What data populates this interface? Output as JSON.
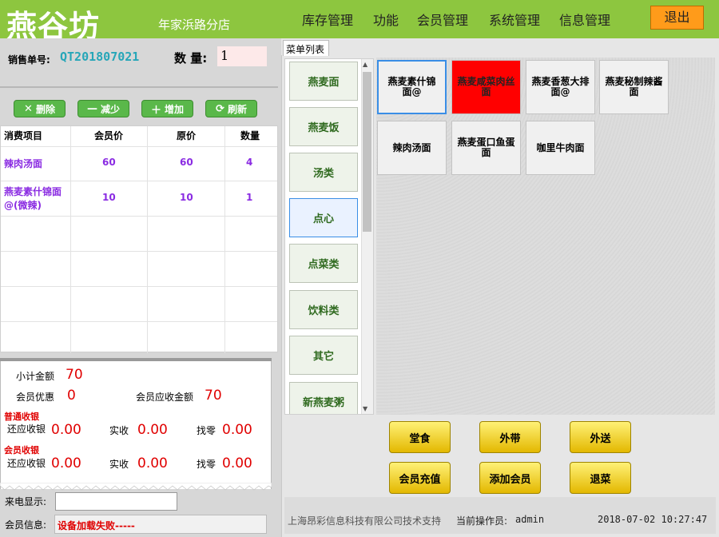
{
  "header": {
    "logo": "燕谷坊",
    "branch": "年家浜路分店",
    "menus": [
      "库存管理",
      "功能",
      "会员管理",
      "系统管理",
      "信息管理"
    ],
    "exit_label": "退出",
    "color": "#8dc63f"
  },
  "order": {
    "no_label": "销售单号:",
    "no": "QT201807021",
    "qty_label": "数 量:",
    "qty": "1"
  },
  "actions": {
    "delete": "删除",
    "decrease": "减少",
    "increase": "增加",
    "refresh": "刷新"
  },
  "table": {
    "columns": [
      "消费项目",
      "会员价",
      "原价",
      "数量"
    ],
    "rows": [
      {
        "item": "辣肉汤面",
        "member_price": "60",
        "price": "60",
        "qty": "4"
      },
      {
        "item": "燕麦素什锦面@(微辣)",
        "member_price": "10",
        "price": "10",
        "qty": "1"
      }
    ]
  },
  "summary": {
    "subtotal_label": "小计金额",
    "subtotal": "70",
    "discount_label": "会员优惠",
    "discount": "0",
    "member_due_label": "会员应收金额",
    "member_due": "70",
    "normal_head": "普通收银",
    "member_head": "会员收银",
    "due_label": "还应收银",
    "paid_label": "实收",
    "change_label": "找零",
    "normal_due": "0.00",
    "normal_paid": "0.00",
    "normal_change": "0.00",
    "member_due2": "0.00",
    "member_paid": "0.00",
    "member_change": "0.00"
  },
  "caller": {
    "label": "来电显示:",
    "value": ""
  },
  "member": {
    "label": "会员信息:",
    "value": "设备加载失败-----"
  },
  "tab_label": "菜单列表",
  "categories": [
    "燕麦面",
    "燕麦饭",
    "汤类",
    "点心",
    "点菜类",
    "饮料类",
    "其它",
    "新燕麦粥"
  ],
  "dishes": [
    "燕麦素什锦面@",
    "燕麦咸菜肉丝面",
    "燕麦香葱大排面@",
    "燕麦秘制辣酱面",
    "辣肉汤面",
    "燕麦蛋口鱼蛋面",
    "咖里牛肉面"
  ],
  "bottom_buttons": [
    "堂食",
    "外带",
    "外送",
    "会员充值",
    "添加会员",
    "退菜"
  ],
  "footer": {
    "support": "上海昂彩信息科技有限公司技术支持",
    "operator_label": "当前操作员:",
    "operator": "admin",
    "datetime": "2018-07-02  10:27:47"
  }
}
